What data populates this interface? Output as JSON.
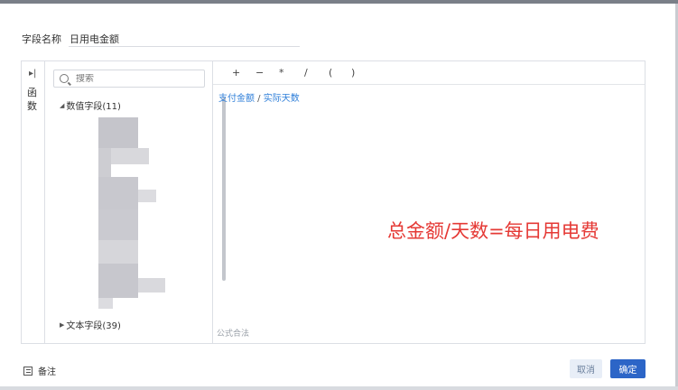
{
  "field": {
    "label": "字段名称",
    "value": "日用电金额"
  },
  "functions": {
    "label": "函数"
  },
  "search": {
    "placeholder": "搜索"
  },
  "tree": [
    {
      "label": "数值字段(11)",
      "expanded": true
    },
    {
      "label": "文本字段(39)",
      "expanded": false
    }
  ],
  "operators": [
    "+",
    "−",
    "*",
    "/",
    "(",
    ")"
  ],
  "formula": {
    "part1": "支付金额",
    "sep": " / ",
    "part2": "实际天数",
    "status": "公式合法"
  },
  "annotation": "总金额/天数=每日用电费",
  "footer": {
    "note_label": "备注",
    "cancel_label": "取消",
    "ok_label": "确定"
  },
  "colors": {
    "primary": "#2c65c7",
    "link": "#2f7fd9",
    "annotation": "#e53935"
  }
}
